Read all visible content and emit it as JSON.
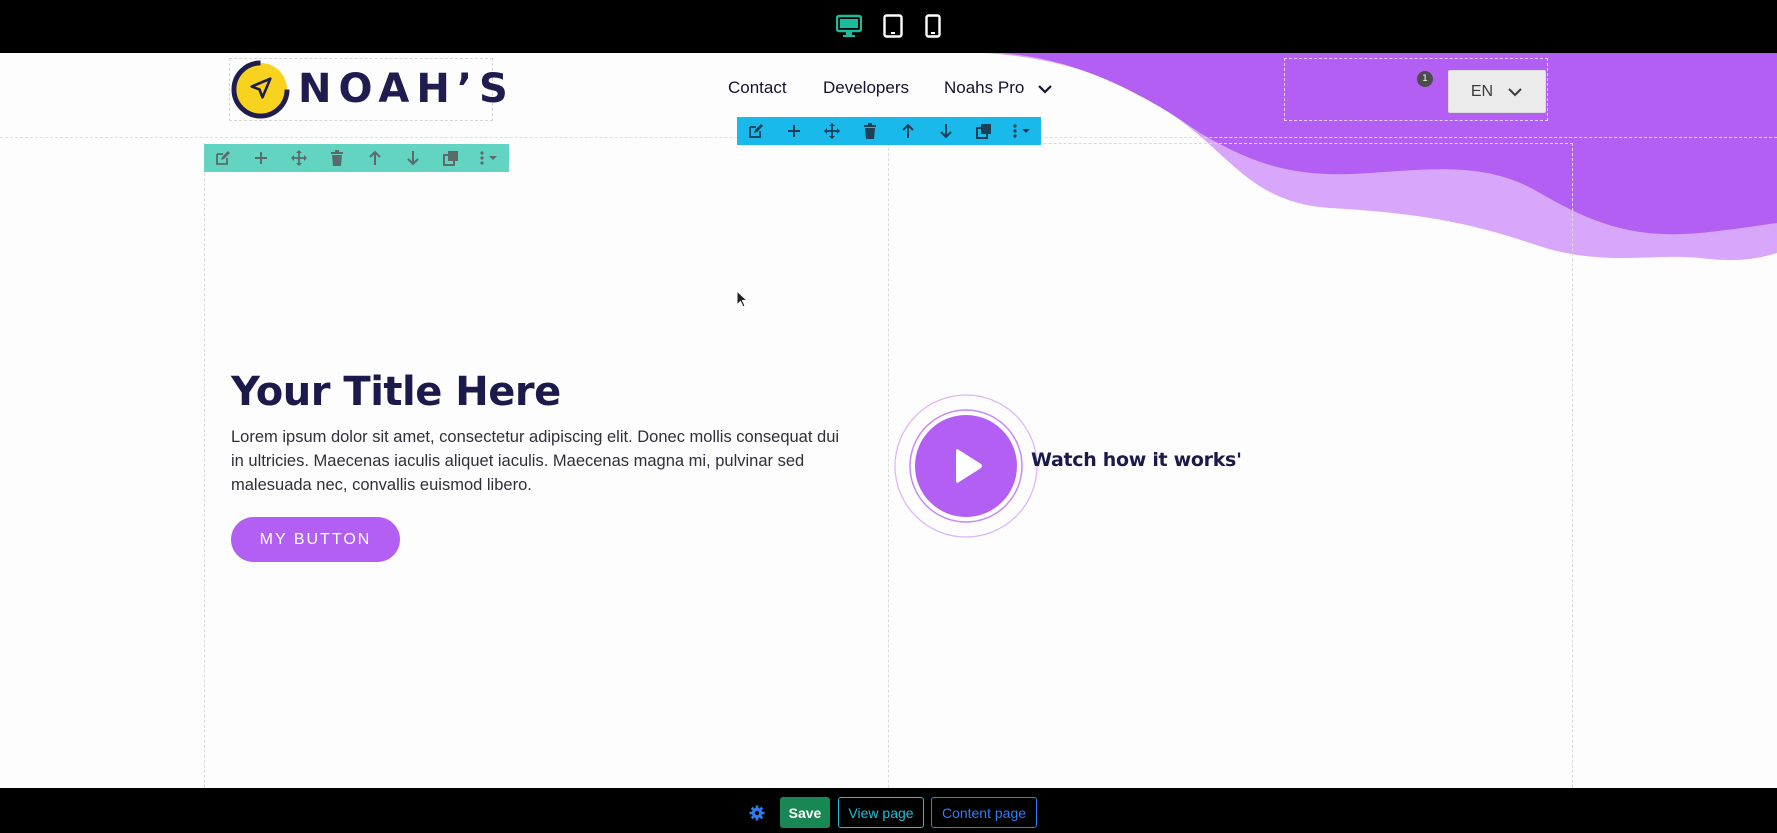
{
  "device_bar": {
    "icons": [
      "desktop-icon",
      "tablet-icon",
      "mobile-icon"
    ],
    "active_color": "#1abc9c"
  },
  "header": {
    "logo_text": "NOAH’S",
    "nav": [
      "Contact",
      "Developers",
      "Noahs Pro"
    ],
    "badge_count": "1",
    "language": "EN"
  },
  "toolbar_icons": [
    "edit-icon",
    "add-icon",
    "move-icon",
    "delete-icon",
    "arrow-up-icon",
    "arrow-down-icon",
    "duplicate-icon",
    "more-icon"
  ],
  "hero": {
    "title": "Your Title Here",
    "text": "Lorem ipsum dolor sit amet, consectetur adipiscing elit. Donec mollis consequat dui in ultricies. Maecenas iaculis aliquet iaculis. Maecenas magna mi, pulvinar sed malesuada nec, convallis euismod libero.",
    "button": "MY BUTTON"
  },
  "video": {
    "label": "Watch how it works'"
  },
  "bottom_bar": {
    "save": "Save",
    "view": "View page",
    "content": "Content page"
  },
  "colors": {
    "brand_purple": "#b35ff3",
    "navy": "#1c1a4a",
    "logo_yellow": "#f7d21e",
    "toolbar_blue": "#19b9ec",
    "toolbar_green": "#63d4c2",
    "save_green": "#198754"
  }
}
